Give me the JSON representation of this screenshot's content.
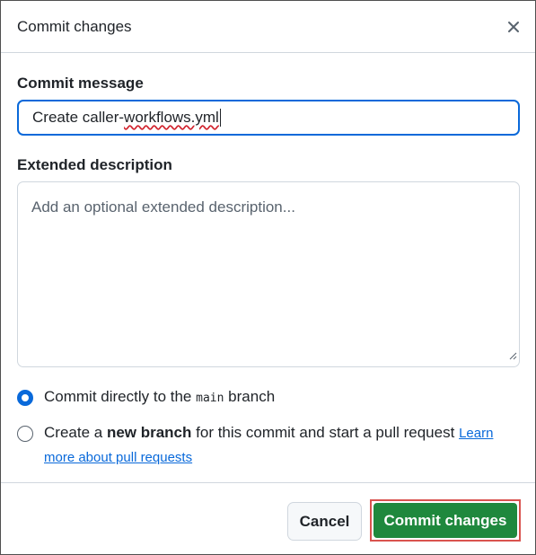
{
  "dialog": {
    "title": "Commit changes",
    "close_icon": "x-icon"
  },
  "commit_message": {
    "label": "Commit message",
    "value_prefix": "Create caller-",
    "value_misspelled": "workflows.yml"
  },
  "extended_description": {
    "label": "Extended description",
    "placeholder": "Add an optional extended description..."
  },
  "options": {
    "direct": {
      "prefix": "Commit directly to the",
      "branch": "main",
      "suffix": "branch",
      "selected": true
    },
    "new_branch": {
      "prefix": "Create a",
      "bold": "new branch",
      "suffix": "for this commit and start a pull request",
      "link": "Learn more about pull requests",
      "selected": false
    }
  },
  "footer": {
    "cancel_label": "Cancel",
    "commit_label": "Commit changes"
  },
  "colors": {
    "accent": "#0969da",
    "primary_button": "#1f883d",
    "highlight_outline": "#d9534f"
  }
}
